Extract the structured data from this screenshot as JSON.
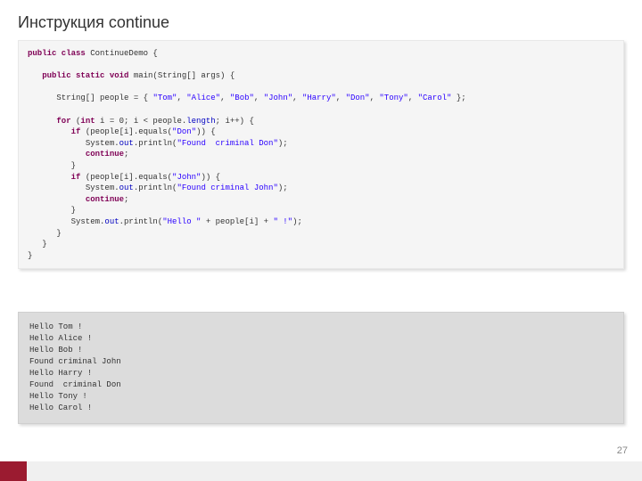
{
  "title": "Инструкция continue",
  "code": {
    "indent0": "public class",
    "className": " ContinueDemo {",
    "mainSig1": "public static void",
    "mainSig2": " main(String[] args) {",
    "arrDecl": "      String[] people = { ",
    "s1": "\"Tom\"",
    "s2": "\"Alice\"",
    "s3": "\"Bob\"",
    "s4": "\"John\"",
    "s5": "\"Harry\"",
    "s6": "\"Don\"",
    "s7": "\"Tony\"",
    "s8": "\"Carol\"",
    "arrEnd": " };",
    "forKw": "for",
    "forCond1": " (",
    "intKw": "int",
    "forCond2": " i = 0; i < people.",
    "lenFld": "length",
    "forCond3": "; i++) {",
    "ifKw": "if",
    "if1cond": " (people[i].equals(",
    "don": "\"Don\"",
    "if1end": ")) {",
    "sysout": "System.",
    "outFld": "out",
    "println": ".println(",
    "msgDon": "\"Found  criminal Don\"",
    "close": ");",
    "contKw": "continue",
    "john": "\"John\"",
    "if2end": ")) {",
    "msgJohn": "\"Found criminal John\"",
    "hello": "\"Hello \"",
    "plus": " + people[i] + ",
    "excl": "\" !\"",
    "rbrace": "}"
  },
  "output": "Hello Tom !\nHello Alice !\nHello Bob !\nFound criminal John\nHello Harry !\nFound  criminal Don\nHello Tony !\nHello Carol !",
  "pageNumber": "27"
}
